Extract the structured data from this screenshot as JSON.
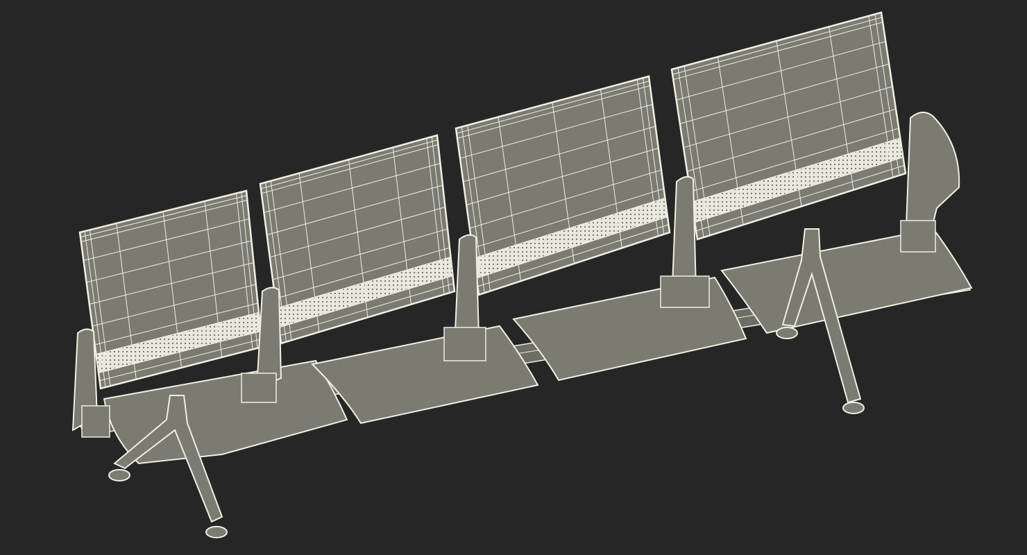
{
  "scene": {
    "subject": "wireframe-render",
    "seat_count": 4,
    "leg_count": 2,
    "colors": {
      "background": "#262626",
      "surface": "#7b7b71",
      "surface_dark": "#686860",
      "wire": "#f0efe4",
      "perforated_band": "#e4e3d6"
    }
  }
}
